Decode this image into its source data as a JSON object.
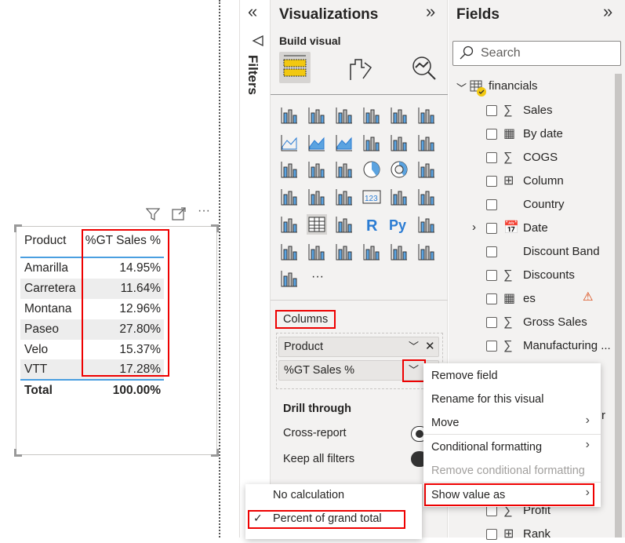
{
  "visual": {
    "columns": [
      "Product",
      "%GT Sales %"
    ],
    "rows": [
      {
        "product": "Amarilla",
        "value": "14.95%"
      },
      {
        "product": "Carretera",
        "value": "11.64%"
      },
      {
        "product": "Montana",
        "value": "12.96%"
      },
      {
        "product": "Paseo",
        "value": "27.80%"
      },
      {
        "product": "Velo",
        "value": "15.37%"
      },
      {
        "product": "VTT",
        "value": "17.28%"
      }
    ],
    "total_label": "Total",
    "total_value": "100.00%",
    "more_label": "···"
  },
  "filters": {
    "label": "Filters",
    "collapse": "«"
  },
  "visualizations": {
    "title": "Visualizations",
    "expand": "»",
    "build_visual": "Build visual",
    "more_visuals": "···",
    "columns_label": "Columns",
    "wells": [
      "Product",
      "%GT Sales %"
    ],
    "drill_through": "Drill through",
    "cross_report": "Cross-report",
    "keep_all_filters": "Keep all filters",
    "accent": "#f2c811"
  },
  "fields": {
    "title": "Fields",
    "expand": "»",
    "search_placeholder": "Search",
    "table_name": "financials",
    "items": [
      {
        "label": "Sales",
        "icon": "∑"
      },
      {
        "label": "By date",
        "icon": "▦"
      },
      {
        "label": "COGS",
        "icon": "∑"
      },
      {
        "label": "Column",
        "icon": "⊞"
      },
      {
        "label": "Country",
        "icon": ""
      },
      {
        "label": "Date",
        "icon": "📅"
      },
      {
        "label": "Discount Band",
        "icon": ""
      },
      {
        "label": "Discounts",
        "icon": "∑"
      },
      {
        "label": "es",
        "icon": "▦"
      },
      {
        "label": "Gross Sales",
        "icon": "∑"
      },
      {
        "label": "Manufacturing ...",
        "icon": "∑"
      },
      {
        "label": "Profit",
        "icon": "∑"
      },
      {
        "label": "Rank",
        "icon": "⊞"
      }
    ],
    "partial_r": "r"
  },
  "context_menu": {
    "items": [
      "Remove field",
      "Rename for this visual",
      "Move",
      "Conditional formatting",
      "Remove conditional formatting",
      "Show value as"
    ]
  },
  "submenu": {
    "items": [
      "No calculation",
      "Percent of grand total"
    ],
    "checked": "Percent of grand total"
  }
}
